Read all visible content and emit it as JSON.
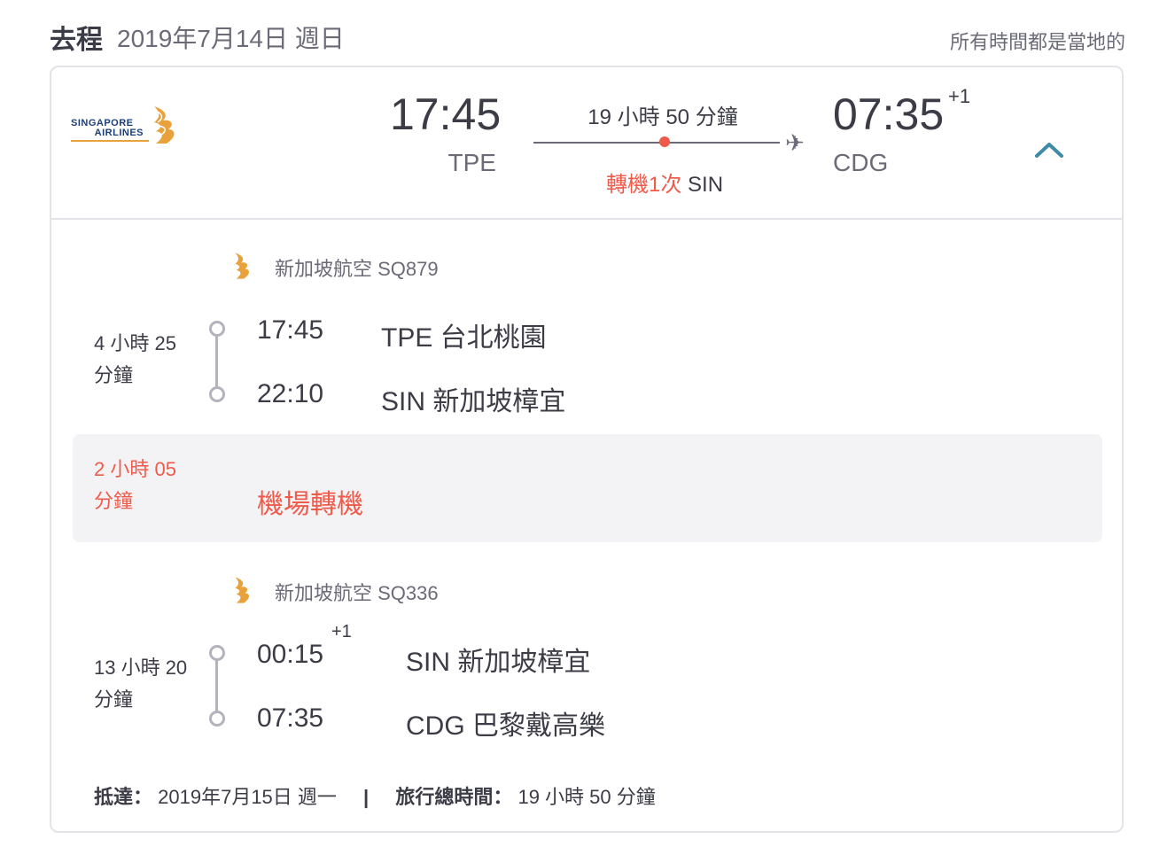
{
  "header": {
    "direction": "去程",
    "date": "2019年7月14日 週日",
    "time_note": "所有時間都是當地的"
  },
  "summary": {
    "airline_logo_text_line1": "SINGAPORE",
    "airline_logo_text_line2": "AIRLINES",
    "departure_time": "17:45",
    "departure_code": "TPE",
    "total_duration": "19 小時 50 分鐘",
    "stops_label": "轉機1次",
    "stops_airport": "SIN",
    "arrival_time": "07:35",
    "arrival_day_offset": "+1",
    "arrival_code": "CDG"
  },
  "segments": [
    {
      "airline_flight": "新加坡航空 SQ879",
      "duration_line1": "4 小時 25",
      "duration_line2": "分鐘",
      "dep_time": "17:45",
      "dep_airport": "TPE 台北桃園",
      "arr_time": "22:10",
      "arr_airport": "SIN 新加坡樟宜"
    },
    {
      "airline_flight": "新加坡航空 SQ336",
      "duration_line1": "13 小時 20",
      "duration_line2": "分鐘",
      "dep_time": "00:15",
      "dep_day_offset": "+1",
      "dep_airport": "SIN 新加坡樟宜",
      "arr_time": "07:35",
      "arr_airport": "CDG 巴黎戴高樂"
    }
  ],
  "layover": {
    "duration_line1": "2 小時 05",
    "duration_line2": "分鐘",
    "label": "機場轉機"
  },
  "footer": {
    "arrival_label": "抵達：",
    "arrival_value": "2019年7月15日 週一",
    "separator": "|",
    "total_label": "旅行總時間：",
    "total_value": "19 小時 50 分鐘"
  },
  "colors": {
    "accent_red": "#f05a4a",
    "chevron_blue": "#3f8aa6",
    "brand_orange": "#e9a13b"
  },
  "icons": {
    "logo": "singapore-airlines-bird-icon",
    "plane": "airplane-icon",
    "collapse": "chevron-up-icon"
  }
}
